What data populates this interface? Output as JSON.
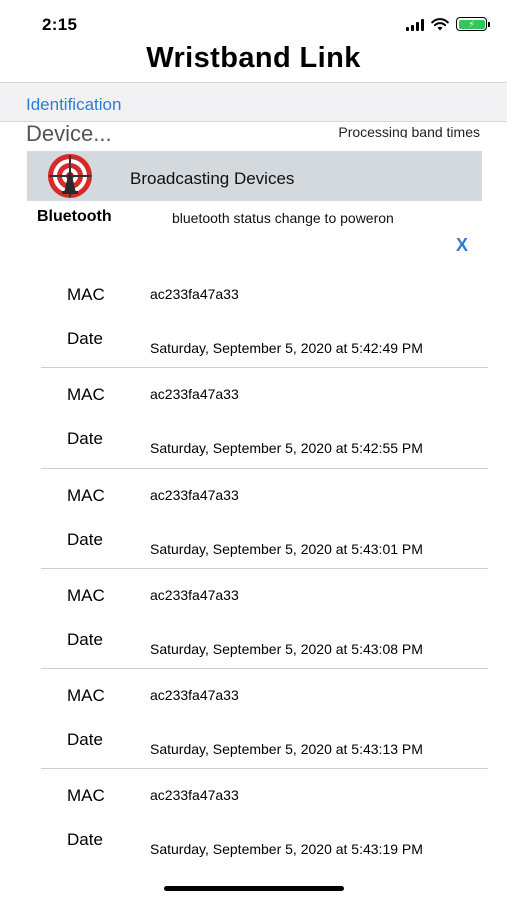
{
  "status_bar": {
    "time": "2:15"
  },
  "nav": {
    "title": "Wristband Link"
  },
  "segment": {
    "identification": "Identification"
  },
  "header": {
    "device_title": "Device...",
    "processing": "Processing band times",
    "banner_label": "Broadcasting Devices"
  },
  "bluetooth": {
    "label": "Bluetooth",
    "status": "bluetooth status change to poweron",
    "close": "X"
  },
  "devices": [
    {
      "mac_label": "MAC",
      "mac": "ac233fa47a33",
      "date_label": "Date",
      "date": "Saturday, September 5, 2020 at 5:42:49 PM"
    },
    {
      "mac_label": "MAC",
      "mac": "ac233fa47a33",
      "date_label": "Date",
      "date": "Saturday, September 5, 2020 at 5:42:55 PM"
    },
    {
      "mac_label": "MAC",
      "mac": "ac233fa47a33",
      "date_label": "Date",
      "date": "Saturday, September 5, 2020 at 5:43:01 PM"
    },
    {
      "mac_label": "MAC",
      "mac": "ac233fa47a33",
      "date_label": "Date",
      "date": "Saturday, September 5, 2020 at 5:43:08 PM"
    },
    {
      "mac_label": "MAC",
      "mac": "ac233fa47a33",
      "date_label": "Date",
      "date": "Saturday, September 5, 2020 at 5:43:13 PM"
    },
    {
      "mac_label": "MAC",
      "mac": "ac233fa47a33",
      "date_label": "Date",
      "date": "Saturday, September 5, 2020 at 5:43:19 PM"
    }
  ],
  "colors": {
    "accent": "#2f7bd6",
    "banner": "#d3d9dc",
    "battery": "#33c759"
  },
  "icons": [
    "signal-icon",
    "wifi-icon",
    "battery-icon",
    "target-logo-icon",
    "close-icon"
  ]
}
